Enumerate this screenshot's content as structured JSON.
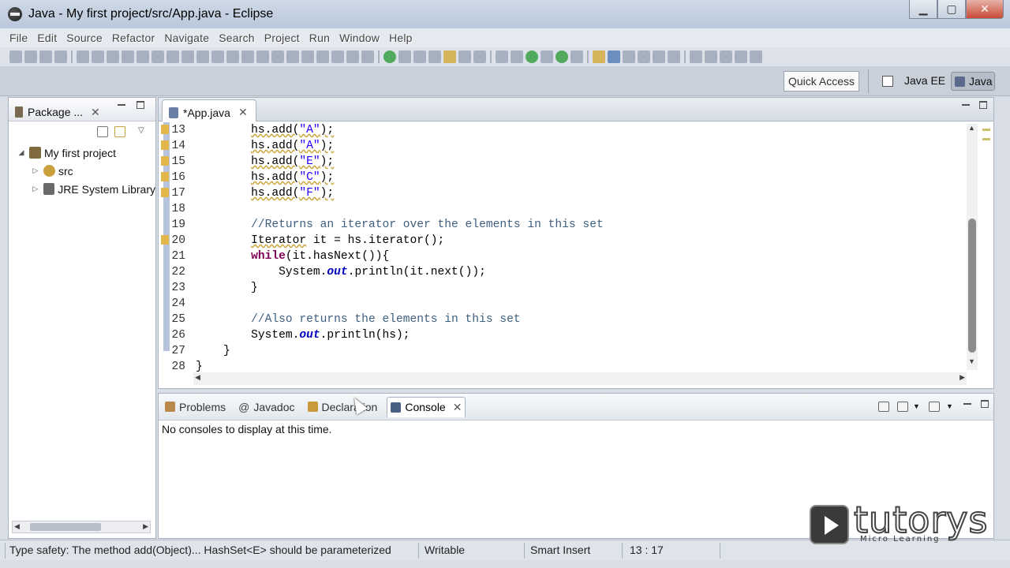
{
  "window": {
    "title": "Java - My first project/src/App.java - Eclipse",
    "minimize": "▁",
    "maximize": "▢",
    "close": "✕"
  },
  "menu": [
    "File",
    "Edit",
    "Source",
    "Refactor",
    "Navigate",
    "Search",
    "Project",
    "Run",
    "Window",
    "Help"
  ],
  "toolbar": {
    "quick_access": "Quick Access",
    "perspectives": [
      "Java EE",
      "Java"
    ]
  },
  "package_explorer": {
    "tab_label": "Package ...",
    "tree": [
      {
        "label": "My first project",
        "arrow": "◢"
      },
      {
        "label": "src",
        "arrow": "▷"
      },
      {
        "label": "JRE System Library",
        "arrow": "▷"
      }
    ]
  },
  "editor": {
    "tab_label": "*App.java",
    "lines": [
      {
        "n": "13",
        "warn": true
      },
      {
        "n": "14",
        "warn": true
      },
      {
        "n": "15",
        "warn": true
      },
      {
        "n": "16",
        "warn": true
      },
      {
        "n": "17",
        "warn": true
      },
      {
        "n": "18",
        "warn": false
      },
      {
        "n": "19",
        "warn": false
      },
      {
        "n": "20",
        "warn": true
      },
      {
        "n": "21",
        "warn": false
      },
      {
        "n": "22",
        "warn": false
      },
      {
        "n": "23",
        "warn": false
      },
      {
        "n": "24",
        "warn": false
      },
      {
        "n": "25",
        "warn": false
      },
      {
        "n": "26",
        "warn": false
      },
      {
        "n": "27",
        "warn": false
      },
      {
        "n": "28",
        "warn": false
      }
    ],
    "code": {
      "l13": "hs.add(\"A\");",
      "l14": "hs.add(\"A\");",
      "l15": "hs.add(\"E\");",
      "l16": "hs.add(\"C\");",
      "l17": "hs.add(\"F\");",
      "l19": "//Returns an iterator over the elements in this set",
      "l20_type": "Iterator",
      "l20_rest": " it = hs.iterator();",
      "l21_kw": "while",
      "l21_rest": "(it.hasNext()){",
      "l22_a": "System.",
      "l22_out": "out",
      "l22_b": ".println(it.next());",
      "l23": "}",
      "l25": "//Also returns the elements in this set",
      "l26_a": "System.",
      "l26_out": "out",
      "l26_b": ".println(hs);",
      "l27": "}",
      "l28": "}"
    }
  },
  "bottom_panel": {
    "tabs": [
      "Problems",
      "Javadoc",
      "Declaration",
      "Console"
    ],
    "console_message": "No consoles to display at this time."
  },
  "status_bar": {
    "message": "Type safety: The method add(Object)... HashSet<E> should be parameterized",
    "mode": "Writable",
    "insert_mode": "Smart Insert",
    "position": "13 : 17"
  },
  "watermark": {
    "text": "tutorys",
    "subtitle": "Micro Learning"
  },
  "colors": {
    "keyword": "#7f0055",
    "string": "#2a00ff",
    "comment": "#3f5f7f",
    "static_field": "#0000c0"
  }
}
